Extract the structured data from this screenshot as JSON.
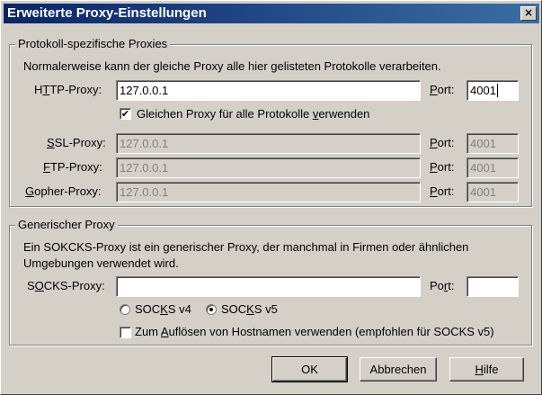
{
  "window": {
    "title": "Erweiterte Proxy-Einstellungen",
    "close_glyph": "×"
  },
  "protocol_group": {
    "legend": "Protokoll-spezifische Proxies",
    "description": "Normalerweise kann der gleiche Proxy alle hier gelisteten Protokolle verarbeiten.",
    "http": {
      "label_pre": "H",
      "label_u": "T",
      "label_post": "TP-Proxy:",
      "value": "127.0.0.1",
      "port": "4001"
    },
    "same_proxy": {
      "checked": "✔",
      "label_pre": "Gleichen Proxy für alle Protokolle ",
      "label_u": "v",
      "label_post": "erwenden"
    },
    "ssl": {
      "label_pre": "",
      "label_u": "S",
      "label_post": "SL-Proxy:",
      "value": "127.0.0.1",
      "port": "4001"
    },
    "ftp": {
      "label_pre": "",
      "label_u": "F",
      "label_post": "TP-Proxy:",
      "value": "127.0.0.1",
      "port": "4001"
    },
    "gopher": {
      "label_pre": "",
      "label_u": "G",
      "label_post": "opher-Proxy:",
      "value": "127.0.0.1",
      "port": "4001"
    },
    "port_label_u": "P",
    "port_label_post": "ort:"
  },
  "generic_group": {
    "legend": "Generischer Proxy",
    "description_line1": "Ein SOKCKS-Proxy ist ein generischer Proxy, der manchmal in Firmen oder ähnlichen",
    "description_line2": "Umgebungen verwendet wird.",
    "socks": {
      "label_pre": "S",
      "label_u": "O",
      "label_post": "CKS-Proxy:",
      "value": "",
      "port": ""
    },
    "port_label_pre": "Po",
    "port_label_u": "r",
    "port_label_post": "t:",
    "socks_v4": {
      "label_pre": "SOC",
      "label_u": "K",
      "label_post": "S v4"
    },
    "socks_v5": {
      "label_pre": "SOC",
      "label_u": "K",
      "label_post": "S v5"
    },
    "resolve_hostnames": {
      "label_pre": "Zum ",
      "label_u": "A",
      "label_post": "uflösen von Hostnamen verwenden (empfohlen für SOCKS v5)"
    }
  },
  "buttons": {
    "ok": "OK",
    "cancel": "Abbrechen",
    "help_u": "H",
    "help_post": "ilfe"
  }
}
